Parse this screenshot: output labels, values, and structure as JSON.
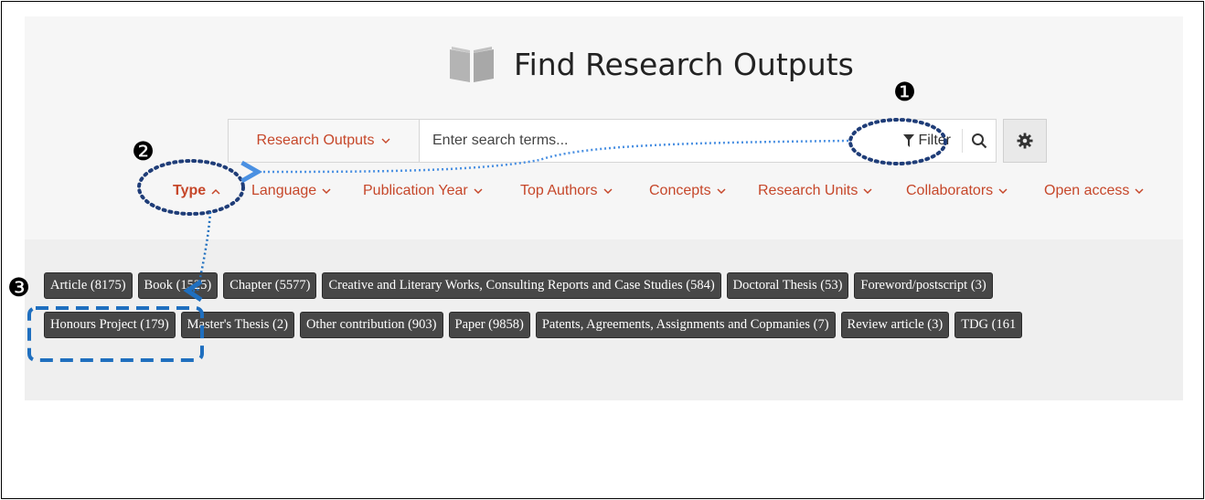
{
  "page": {
    "title": "Find Research Outputs"
  },
  "search": {
    "scope_label": "Research Outputs",
    "placeholder": "Enter search terms...",
    "filter_label": "Filter"
  },
  "facets": [
    {
      "label": "Type",
      "expanded": true
    },
    {
      "label": "Language"
    },
    {
      "label": "Publication Year"
    },
    {
      "label": "Top Authors"
    },
    {
      "label": "Concepts"
    },
    {
      "label": "Research Units"
    },
    {
      "label": "Collaborators"
    },
    {
      "label": "Open access"
    }
  ],
  "type_tags": {
    "row1": [
      "Article (8175)",
      "Book (1525)",
      "Chapter (5577)",
      "Creative and Literary Works, Consulting Reports and Case Studies (584)",
      "Doctoral Thesis (53)",
      "Foreword/postscript (3)"
    ],
    "row2": [
      "Honours Project (179)",
      "Master's Thesis (2)",
      "Other contribution (903)",
      "Paper (9858)",
      "Patents, Agreements, Assignments and Copmanies (7)",
      "Review article (3)",
      "TDG (161"
    ]
  },
  "annotations": {
    "marker_1": "❶",
    "marker_2": "❷",
    "marker_3": "❸"
  },
  "colors": {
    "accent": "#c6472a",
    "tag_bg": "#474747",
    "annotation_dark": "#1f3d78",
    "annotation_light": "#4a90e2",
    "annotation_dashed": "#1f6fbf"
  }
}
